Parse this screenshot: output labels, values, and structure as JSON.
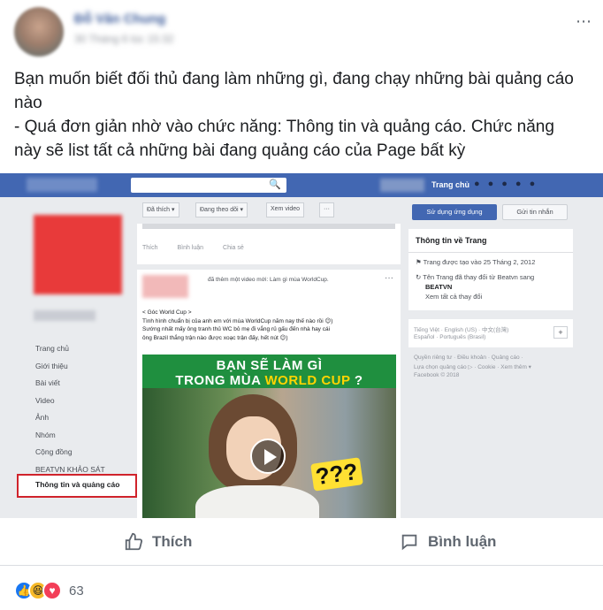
{
  "post": {
    "author": "Đỗ Văn Chung",
    "time": "30 Tháng 6 lúc 15:32",
    "more_icon": "⋯",
    "text_lines": [
      "Bạn muốn biết đối thủ đang làm những gì, đang chạy những bài quảng cáo",
      "nào",
      "- Quá đơn giản nhờ vào chức năng: Thông tin và quảng cáo. Chức năng",
      "này sẽ list tất cả những bài đang quảng cáo của Page bất kỳ"
    ]
  },
  "screenshot": {
    "topbar": {
      "home": "Trang chủ"
    },
    "left_nav": [
      "Trang chủ",
      "Giới thiệu",
      "Bài viết",
      "Video",
      "Ảnh",
      "Nhóm",
      "Cộng đồng",
      "BEATVN KHẢO SÁT"
    ],
    "left_nav_selected": "Thông tin và quảng cáo",
    "action_bar": {
      "liked": "Đã thích ▾",
      "following": "Đang theo dõi ▾",
      "watch": "Xem video",
      "more": "···"
    },
    "feed1_reactions": [
      "Thích",
      "Bình luận",
      "Chia sẻ"
    ],
    "feed2": {
      "header": "đã thêm một video mới: Làm gì mùa WorldCup.",
      "text": [
        "< Góc World Cup >",
        "Tình hình chuẩn bị của anh em với mùa WorldCup năm nay thế nào rồi 😉)",
        "Sướng nhất mấy ông tranh thủ WC bỏ mẹ đi vắng rủ gấu đến nhà hay cái",
        "ông Brazil thắng trận nào được xoạc trận đấy, hết nút 😉)"
      ],
      "video_title_1": "BẠN SẼ LÀM GÌ",
      "video_title_2": "TRONG MÙA",
      "video_title_wc": "WORLD CUP",
      "video_title_q": " ?",
      "qqq": "???"
    },
    "right": {
      "use_app": "Sử dụng ứng dụng",
      "send_msg": "Gửi tin nhắn",
      "info_title": "Thông tin về Trang",
      "created": "Trang được tạo vào 25 Tháng 2, 2012",
      "renamed_prefix": "Tên Trang đã thay đổi từ Beatvn sang",
      "renamed_to": "BEATVN",
      "see_all": "Xem tất cả thay đổi",
      "lang_1": "Tiếng Việt · English (US) · 中文(台灣)",
      "lang_2": "Español · Português (Brasil)",
      "footer_1": "Quyền riêng tư · Điều khoản · Quảng cáo ·",
      "footer_2": "Lựa chọn quảng cáo ▷ · Cookie · Xem thêm ▾",
      "footer_3": "Facebook © 2018"
    }
  },
  "actions": {
    "like": "Thích",
    "comment": "Bình luận"
  },
  "reactions": {
    "count": "63",
    "icons": [
      "like-icon",
      "haha-icon",
      "love-icon"
    ]
  },
  "colors": {
    "fb_blue": "#4267b2",
    "highlight_red": "#d0232b",
    "page_red": "#e83a3a"
  }
}
